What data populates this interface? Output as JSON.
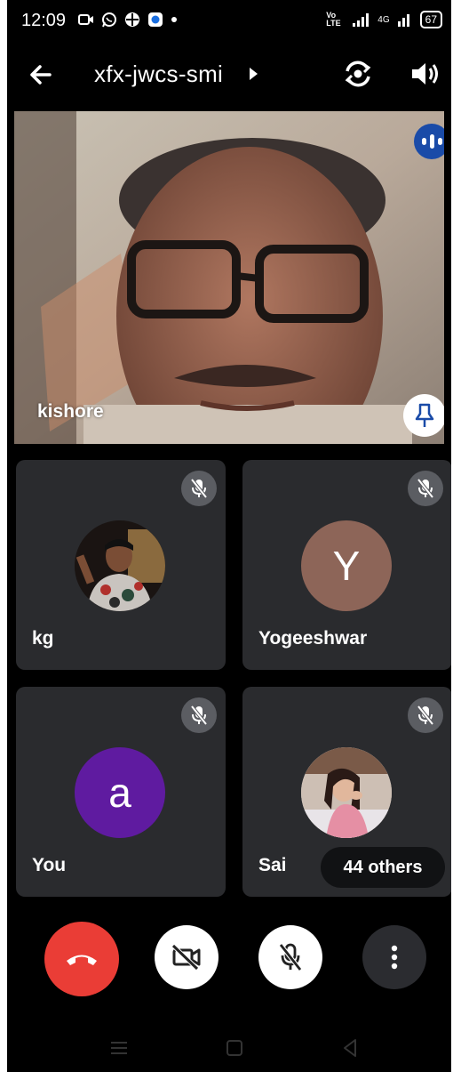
{
  "status_bar": {
    "time": "12:09",
    "network": "Vo LTE",
    "signal_label": "4G",
    "battery": "67"
  },
  "app_bar": {
    "meeting_code": "xfx-jwcs-smi"
  },
  "main_tile": {
    "name": "kishore",
    "speaking": true,
    "pinnable": true
  },
  "participants": [
    {
      "name": "kg",
      "avatar": "photo",
      "muted": true
    },
    {
      "name": "Yogeeshwar",
      "avatar_letter": "Y",
      "avatar_color": "#8d6558",
      "muted": true
    },
    {
      "name": "You",
      "avatar_letter": "a",
      "avatar_color": "#5f1ba0",
      "muted": true
    },
    {
      "name": "Sai",
      "avatar": "photo",
      "muted": true,
      "overflow_label": "44 others"
    }
  ],
  "controls": {
    "end_call_color": "#ea3d36",
    "camera": "off",
    "mic": "off"
  },
  "colors": {
    "background": "#000000",
    "tile": "#2a2b2e",
    "speaking_badge": "#1a4ba8"
  }
}
